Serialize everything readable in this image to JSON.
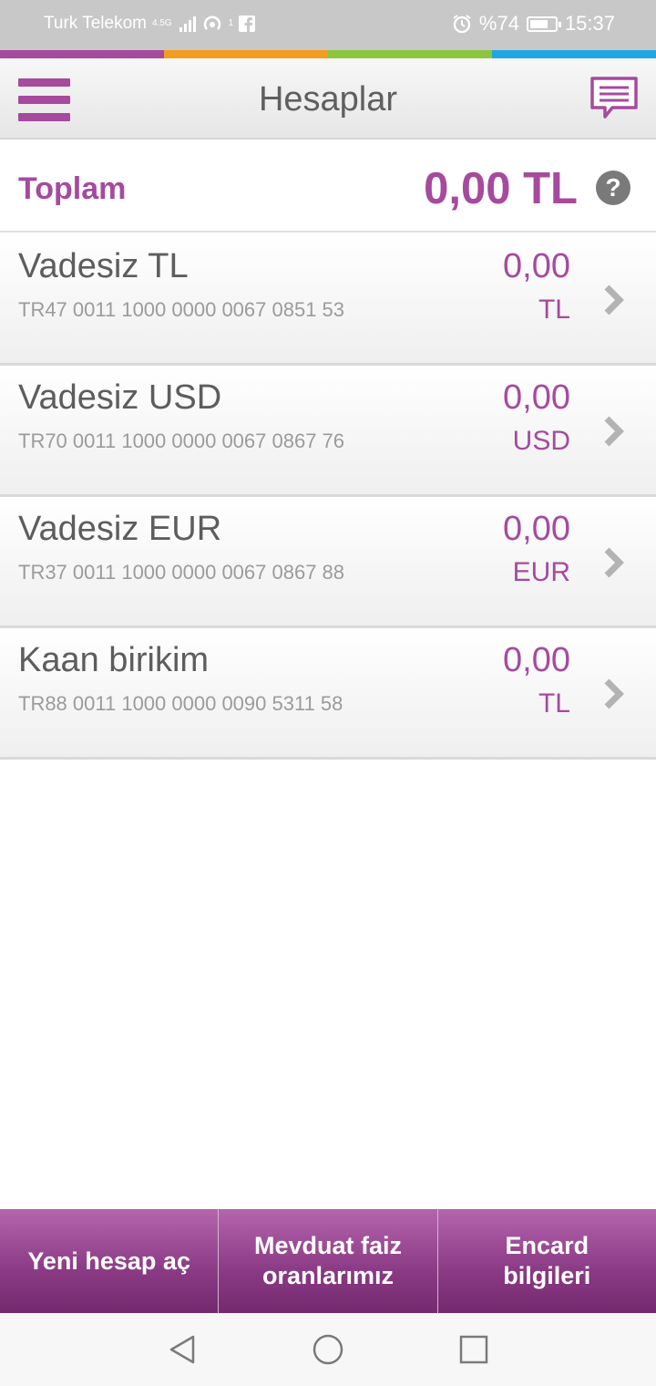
{
  "status_bar": {
    "carrier": "Turk Telekom",
    "network": "4.5G",
    "hotspot_count": "1",
    "battery": "%74",
    "battery_level": 0.74,
    "time": "15:37"
  },
  "brand_strip_colors": [
    "#a64a9e",
    "#f39c1f",
    "#8cc63f",
    "#1ea7e1"
  ],
  "header": {
    "title": "Hesaplar",
    "menu_icon": "hamburger-menu-icon",
    "chat_icon": "message-icon"
  },
  "total": {
    "label": "Toplam",
    "amount": "0,00 TL",
    "help_icon": "question-mark-icon"
  },
  "accounts": [
    {
      "name": "Vadesiz TL",
      "iban": "TR47 0011 1000 0000 0067 0851 53",
      "amount": "0,00",
      "currency": "TL"
    },
    {
      "name": "Vadesiz USD",
      "iban": "TR70 0011 1000 0000 0067 0867 76",
      "amount": "0,00",
      "currency": "USD"
    },
    {
      "name": "Vadesiz EUR",
      "iban": "TR37 0011 1000 0000 0067 0867 88",
      "amount": "0,00",
      "currency": "EUR"
    },
    {
      "name": "Kaan birikim",
      "iban": "TR88 0011 1000 0000 0090 5311 58",
      "amount": "0,00",
      "currency": "TL"
    }
  ],
  "actions": {
    "new_account": "Yeni hesap aç",
    "interest_rates_line1": "Mevduat faiz",
    "interest_rates_line2": "oranlarımız",
    "encard_line1": "Encard",
    "encard_line2": "bilgileri"
  },
  "colors": {
    "accent": "#a64a9e",
    "status_bar": "#c8c8c8"
  }
}
